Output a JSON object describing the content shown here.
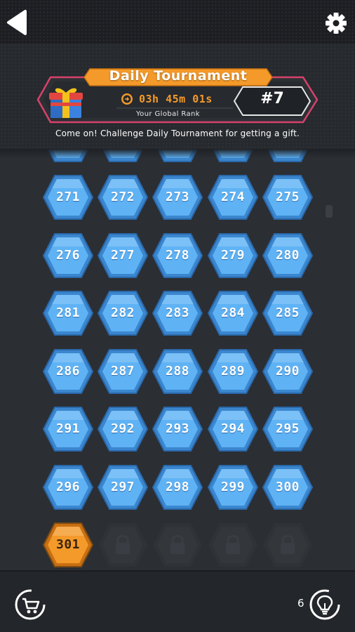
{
  "tournament": {
    "title": "Daily Tournament",
    "timer": "03h 45m 01s",
    "rank_label": "Your Global Rank",
    "rank": "#7",
    "message": "Come on! Challenge Daily Tournament for getting a gift."
  },
  "levels": {
    "completed": [
      "271",
      "272",
      "273",
      "274",
      "275",
      "276",
      "277",
      "278",
      "279",
      "280",
      "281",
      "282",
      "283",
      "284",
      "285",
      "286",
      "287",
      "288",
      "289",
      "290",
      "291",
      "292",
      "293",
      "294",
      "295",
      "296",
      "297",
      "298",
      "299",
      "300"
    ],
    "current": "301",
    "locked_count": 4
  },
  "hints": {
    "count": "6"
  },
  "colors": {
    "background": "#2b2e33",
    "level_blue": "#5fb3f5",
    "level_current": "#f49a2a",
    "banner_border": "#d6426b",
    "banner_title_bg": "#f49a2a"
  },
  "icons": {
    "back": "back-arrow-icon",
    "settings": "gear-icon",
    "gift": "gift-icon",
    "timer": "timer-icon",
    "shop": "shopping-cart-icon",
    "hint": "lightbulb-icon",
    "lock": "lock-icon"
  }
}
